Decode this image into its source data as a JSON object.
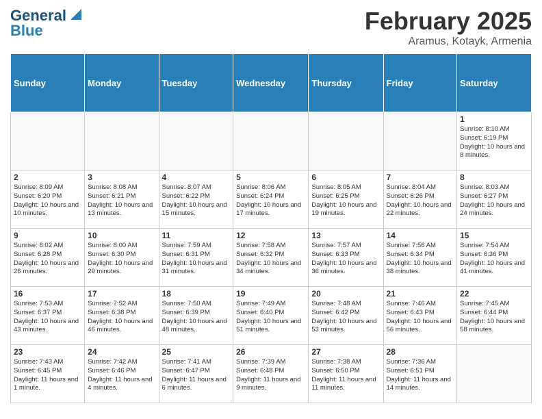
{
  "header": {
    "logo_line1": "General",
    "logo_line2": "Blue",
    "month_title": "February 2025",
    "location": "Aramus, Kotayk, Armenia"
  },
  "weekdays": [
    "Sunday",
    "Monday",
    "Tuesday",
    "Wednesday",
    "Thursday",
    "Friday",
    "Saturday"
  ],
  "weeks": [
    [
      {
        "day": "",
        "info": ""
      },
      {
        "day": "",
        "info": ""
      },
      {
        "day": "",
        "info": ""
      },
      {
        "day": "",
        "info": ""
      },
      {
        "day": "",
        "info": ""
      },
      {
        "day": "",
        "info": ""
      },
      {
        "day": "1",
        "info": "Sunrise: 8:10 AM\nSunset: 6:19 PM\nDaylight: 10 hours and 8 minutes."
      }
    ],
    [
      {
        "day": "2",
        "info": "Sunrise: 8:09 AM\nSunset: 6:20 PM\nDaylight: 10 hours and 10 minutes."
      },
      {
        "day": "3",
        "info": "Sunrise: 8:08 AM\nSunset: 6:21 PM\nDaylight: 10 hours and 13 minutes."
      },
      {
        "day": "4",
        "info": "Sunrise: 8:07 AM\nSunset: 6:22 PM\nDaylight: 10 hours and 15 minutes."
      },
      {
        "day": "5",
        "info": "Sunrise: 8:06 AM\nSunset: 6:24 PM\nDaylight: 10 hours and 17 minutes."
      },
      {
        "day": "6",
        "info": "Sunrise: 8:05 AM\nSunset: 6:25 PM\nDaylight: 10 hours and 19 minutes."
      },
      {
        "day": "7",
        "info": "Sunrise: 8:04 AM\nSunset: 6:26 PM\nDaylight: 10 hours and 22 minutes."
      },
      {
        "day": "8",
        "info": "Sunrise: 8:03 AM\nSunset: 6:27 PM\nDaylight: 10 hours and 24 minutes."
      }
    ],
    [
      {
        "day": "9",
        "info": "Sunrise: 8:02 AM\nSunset: 6:28 PM\nDaylight: 10 hours and 26 minutes."
      },
      {
        "day": "10",
        "info": "Sunrise: 8:00 AM\nSunset: 6:30 PM\nDaylight: 10 hours and 29 minutes."
      },
      {
        "day": "11",
        "info": "Sunrise: 7:59 AM\nSunset: 6:31 PM\nDaylight: 10 hours and 31 minutes."
      },
      {
        "day": "12",
        "info": "Sunrise: 7:58 AM\nSunset: 6:32 PM\nDaylight: 10 hours and 34 minutes."
      },
      {
        "day": "13",
        "info": "Sunrise: 7:57 AM\nSunset: 6:33 PM\nDaylight: 10 hours and 36 minutes."
      },
      {
        "day": "14",
        "info": "Sunrise: 7:56 AM\nSunset: 6:34 PM\nDaylight: 10 hours and 38 minutes."
      },
      {
        "day": "15",
        "info": "Sunrise: 7:54 AM\nSunset: 6:36 PM\nDaylight: 10 hours and 41 minutes."
      }
    ],
    [
      {
        "day": "16",
        "info": "Sunrise: 7:53 AM\nSunset: 6:37 PM\nDaylight: 10 hours and 43 minutes."
      },
      {
        "day": "17",
        "info": "Sunrise: 7:52 AM\nSunset: 6:38 PM\nDaylight: 10 hours and 46 minutes."
      },
      {
        "day": "18",
        "info": "Sunrise: 7:50 AM\nSunset: 6:39 PM\nDaylight: 10 hours and 48 minutes."
      },
      {
        "day": "19",
        "info": "Sunrise: 7:49 AM\nSunset: 6:40 PM\nDaylight: 10 hours and 51 minutes."
      },
      {
        "day": "20",
        "info": "Sunrise: 7:48 AM\nSunset: 6:42 PM\nDaylight: 10 hours and 53 minutes."
      },
      {
        "day": "21",
        "info": "Sunrise: 7:46 AM\nSunset: 6:43 PM\nDaylight: 10 hours and 56 minutes."
      },
      {
        "day": "22",
        "info": "Sunrise: 7:45 AM\nSunset: 6:44 PM\nDaylight: 10 hours and 58 minutes."
      }
    ],
    [
      {
        "day": "23",
        "info": "Sunrise: 7:43 AM\nSunset: 6:45 PM\nDaylight: 11 hours and 1 minute."
      },
      {
        "day": "24",
        "info": "Sunrise: 7:42 AM\nSunset: 6:46 PM\nDaylight: 11 hours and 4 minutes."
      },
      {
        "day": "25",
        "info": "Sunrise: 7:41 AM\nSunset: 6:47 PM\nDaylight: 11 hours and 6 minutes."
      },
      {
        "day": "26",
        "info": "Sunrise: 7:39 AM\nSunset: 6:48 PM\nDaylight: 11 hours and 9 minutes."
      },
      {
        "day": "27",
        "info": "Sunrise: 7:38 AM\nSunset: 6:50 PM\nDaylight: 11 hours and 11 minutes."
      },
      {
        "day": "28",
        "info": "Sunrise: 7:36 AM\nSunset: 6:51 PM\nDaylight: 11 hours and 14 minutes."
      },
      {
        "day": "",
        "info": ""
      }
    ]
  ]
}
